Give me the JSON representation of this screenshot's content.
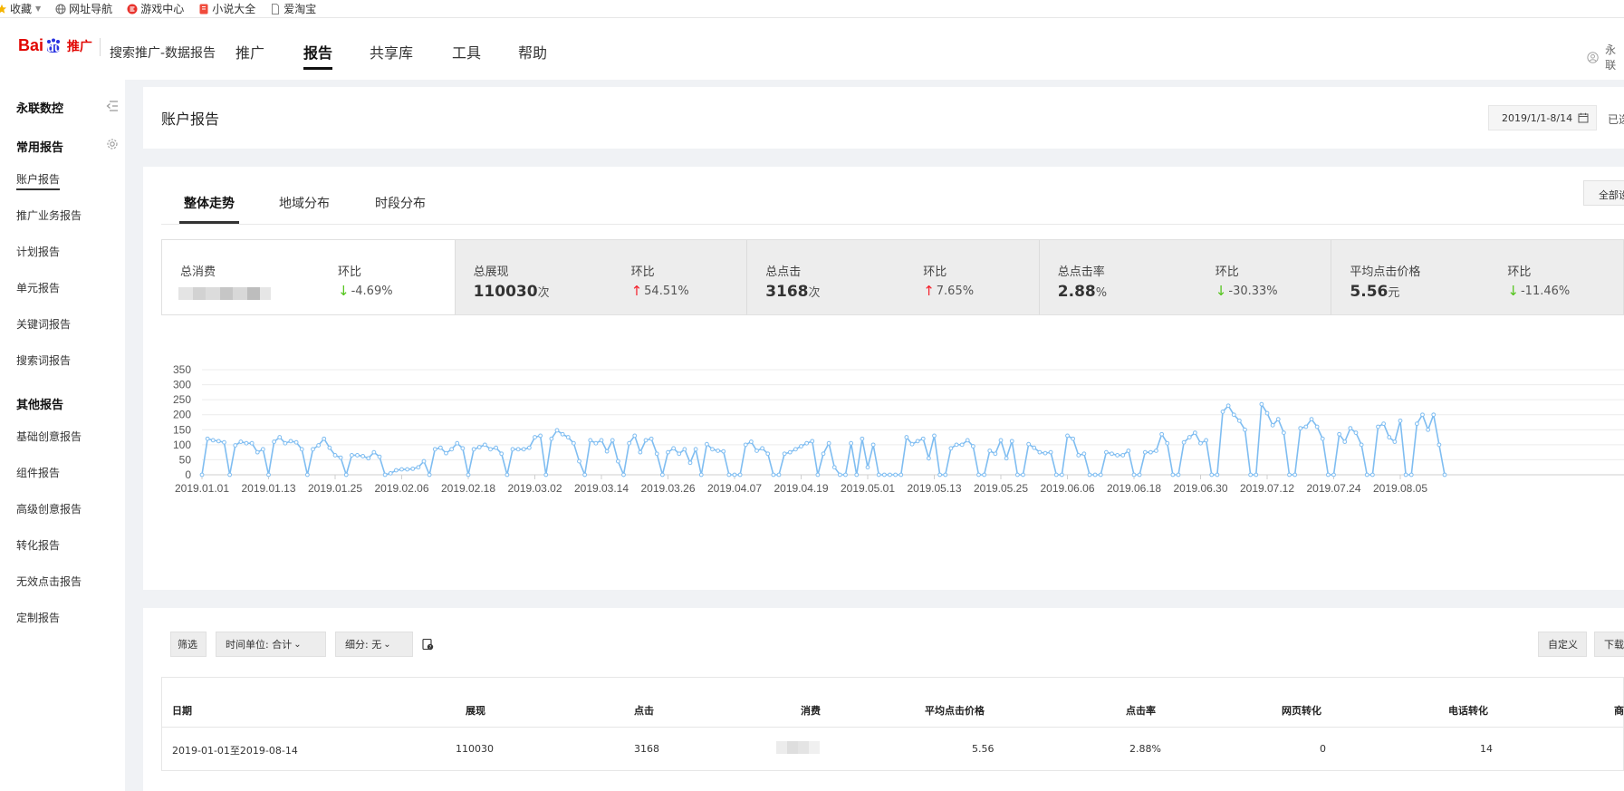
{
  "bookmarks": [
    "收藏",
    "网址导航",
    "游戏中心",
    "小说大全",
    "爱淘宝"
  ],
  "header": {
    "logo_text_left": "Bai",
    "logo_text_right": "du",
    "logo_tuiguang": "推广",
    "subtitle": "搜索推广-数据报告",
    "nav": [
      "推广",
      "报告",
      "共享库",
      "工具",
      "帮助"
    ],
    "active_nav": "报告",
    "user_truncated": "永联"
  },
  "sidebar": {
    "company": "永联数控",
    "common_title": "常用报告",
    "common_items": [
      "账户报告",
      "推广业务报告",
      "计划报告",
      "单元报告",
      "关键词报告",
      "搜索词报告"
    ],
    "other_title": "其他报告",
    "other_items": [
      "基础创意报告",
      "组件报告",
      "高级创意报告",
      "转化报告",
      "无效点击报告",
      "定制报告"
    ]
  },
  "page": {
    "title": "账户报告",
    "date_range": "2019/1/1-8/14",
    "right_trunc": "已选",
    "tabs": [
      "整体走势",
      "地域分布",
      "时段分布"
    ],
    "btn_all_trunc": "全部设"
  },
  "metrics": [
    {
      "name": "总消费",
      "value": "",
      "unit": "",
      "hb_label": "环比",
      "direction": "down",
      "pct": "-4.69%",
      "blurred": true
    },
    {
      "name": "总展现",
      "value": "110030",
      "unit": "次",
      "hb_label": "环比",
      "direction": "up",
      "pct": "54.51%"
    },
    {
      "name": "总点击",
      "value": "3168",
      "unit": "次",
      "hb_label": "环比",
      "direction": "up",
      "pct": "7.65%"
    },
    {
      "name": "总点击率",
      "value": "2.88",
      "unit": "%",
      "hb_label": "环比",
      "direction": "down",
      "pct": "-30.33%"
    },
    {
      "name": "平均点击价格",
      "value": "5.56",
      "unit": "元",
      "hb_label": "环比",
      "direction": "down",
      "pct": "-11.46%"
    }
  ],
  "chart_data": {
    "type": "line",
    "ylim": [
      0,
      350
    ],
    "yticks": [
      0,
      50,
      100,
      150,
      200,
      250,
      300,
      350
    ],
    "xticks": [
      "2019.01.01",
      "2019.01.13",
      "2019.01.25",
      "2019.02.06",
      "2019.02.18",
      "2019.03.02",
      "2019.03.14",
      "2019.03.26",
      "2019.04.07",
      "2019.04.19",
      "2019.05.01",
      "2019.05.13",
      "2019.05.25",
      "2019.06.06",
      "2019.06.18",
      "2019.06.30",
      "2019.07.12",
      "2019.07.24",
      "2019.08.05"
    ],
    "grid": true,
    "legend": "none",
    "color": "#7fbdf1",
    "series": [
      {
        "values": [
          0,
          120,
          115,
          112,
          108,
          0,
          98,
          110,
          105,
          105,
          75,
          85,
          0,
          110,
          125,
          105,
          112,
          108,
          85,
          0,
          85,
          98,
          120,
          90,
          65,
          57,
          0,
          65,
          65,
          62,
          55,
          75,
          60,
          0,
          5,
          15,
          18,
          18,
          20,
          25,
          45,
          0,
          85,
          90,
          72,
          85,
          105,
          88,
          0,
          85,
          92,
          100,
          85,
          90,
          70,
          0,
          85,
          85,
          85,
          90,
          125,
          130,
          0,
          120,
          148,
          135,
          125,
          105,
          45,
          0,
          115,
          105,
          115,
          78,
          115,
          45,
          0,
          105,
          130,
          75,
          115,
          120,
          70,
          0,
          75,
          88,
          70,
          85,
          40,
          85,
          0,
          102,
          85,
          80,
          78,
          0,
          0,
          0,
          100,
          110,
          80,
          88,
          70,
          0,
          0,
          70,
          75,
          85,
          95,
          105,
          112,
          0,
          70,
          105,
          25,
          0,
          0,
          105,
          0,
          120,
          25,
          100,
          0,
          0,
          0,
          0,
          0,
          125,
          102,
          112,
          120,
          55,
          130,
          0,
          0,
          88,
          100,
          100,
          115,
          95,
          0,
          0,
          80,
          70,
          115,
          55,
          112,
          0,
          0,
          102,
          90,
          75,
          72,
          75,
          0,
          0,
          130,
          120,
          65,
          70,
          0,
          0,
          0,
          75,
          70,
          65,
          65,
          80,
          0,
          0,
          75,
          75,
          80,
          135,
          105,
          0,
          0,
          108,
          125,
          140,
          105,
          115,
          0,
          0,
          210,
          230,
          200,
          180,
          150,
          0,
          0,
          235,
          205,
          165,
          185,
          140,
          0,
          0,
          155,
          160,
          185,
          160,
          120,
          0,
          0,
          135,
          110,
          155,
          140,
          100,
          0,
          0,
          160,
          170,
          125,
          110,
          180,
          0,
          0,
          170,
          200,
          150,
          200,
          100,
          0
        ]
      }
    ]
  },
  "table_toolbar": {
    "filter": "筛选",
    "time_unit": "时间单位: 合计",
    "breakdown": "细分: 无",
    "customize": "自定义",
    "download_trunc": "下载"
  },
  "table": {
    "headers": [
      "日期",
      "展现",
      "点击",
      "消费",
      "平均点击价格",
      "点击率",
      "网页转化",
      "电话转化",
      "商"
    ],
    "row": [
      "2019-01-01至2019-08-14",
      "110030",
      "3168",
      "",
      "5.56",
      "2.88%",
      "0",
      "14",
      ""
    ]
  }
}
